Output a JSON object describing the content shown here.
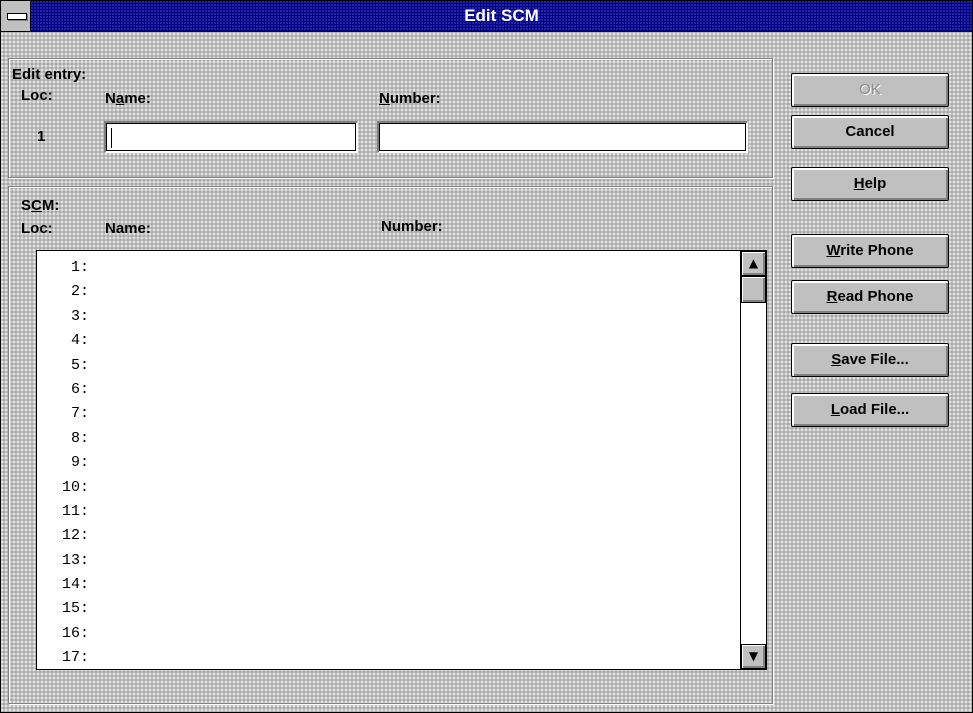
{
  "window": {
    "title": "Edit SCM"
  },
  "edit_entry": {
    "group_label": "Edit entry:",
    "loc_label": "Loc:",
    "name_label_pre": "N",
    "name_label_ul": "a",
    "name_label_post": "me:",
    "number_label_ul": "N",
    "number_label_post": "umber:",
    "loc_value": "1",
    "name_value": "",
    "number_value": ""
  },
  "scm": {
    "group_label_pre": "S",
    "group_label_ul": "C",
    "group_label_post": "M:",
    "loc_label": "Loc:",
    "name_label": "Name:",
    "number_label": "Number:",
    "rows": [
      "1:",
      "2:",
      "3:",
      "4:",
      "5:",
      "6:",
      "7:",
      "8:",
      "9:",
      "10:",
      "11:",
      "12:",
      "13:",
      "14:",
      "15:",
      "16:",
      "17:"
    ],
    "scroll_up_icon": "arrow-up-icon",
    "scroll_down_icon": "arrow-down-icon"
  },
  "buttons": {
    "ok": "OK",
    "cancel": "Cancel",
    "help_ul": "H",
    "help_post": "elp",
    "write_ul": "W",
    "write_post": "rite Phone",
    "read_ul": "R",
    "read_post": "ead Phone",
    "save_ul": "S",
    "save_post": "ave File...",
    "load_ul": "L",
    "load_post": "oad File..."
  }
}
